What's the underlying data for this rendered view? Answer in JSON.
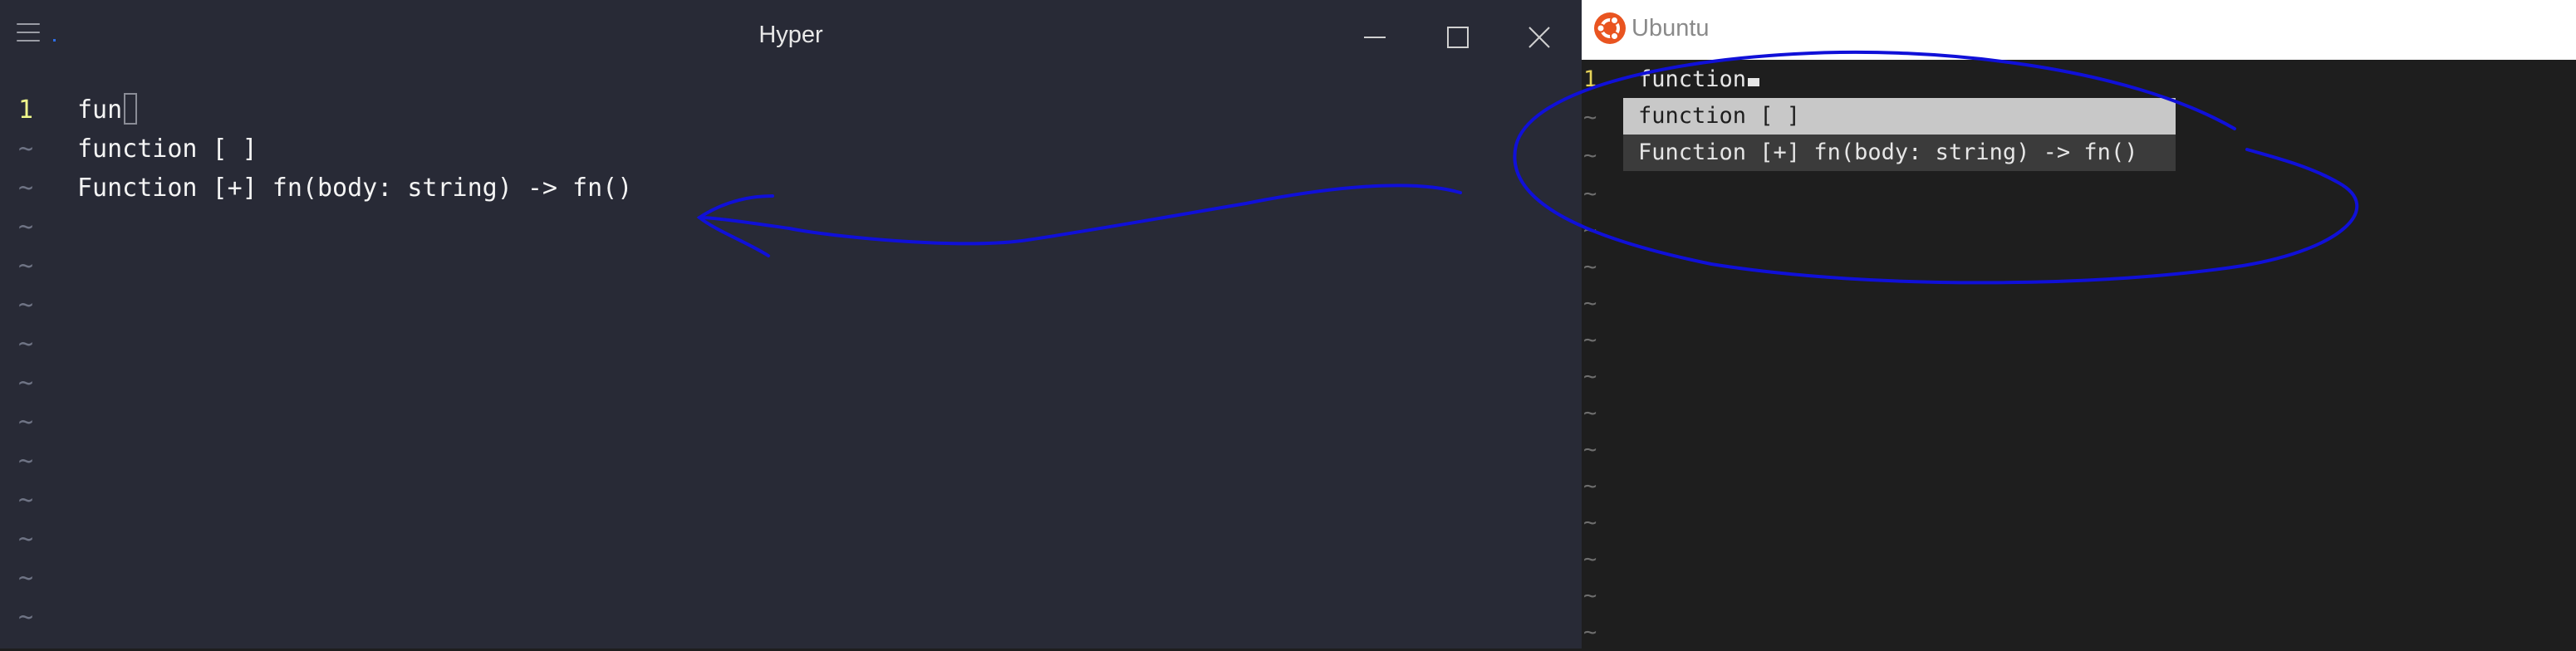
{
  "hyper": {
    "title": "Hyper",
    "lines": [
      {
        "gutter": "1",
        "text": "fun"
      },
      {
        "gutter": "~",
        "text": "function [ ]"
      },
      {
        "gutter": "~",
        "text": "Function [+] fn(body: string) -> fn()"
      },
      {
        "gutter": "~",
        "text": ""
      },
      {
        "gutter": "~",
        "text": ""
      },
      {
        "gutter": "~",
        "text": ""
      },
      {
        "gutter": "~",
        "text": ""
      },
      {
        "gutter": "~",
        "text": ""
      },
      {
        "gutter": "~",
        "text": ""
      },
      {
        "gutter": "~",
        "text": ""
      },
      {
        "gutter": "~",
        "text": ""
      },
      {
        "gutter": "~",
        "text": ""
      },
      {
        "gutter": "~",
        "text": ""
      },
      {
        "gutter": "~",
        "text": ""
      }
    ]
  },
  "ubuntu": {
    "title": "Ubuntu",
    "lines": [
      {
        "gutter": "1",
        "text": "function"
      },
      {
        "gutter": "~",
        "text": ""
      },
      {
        "gutter": "~",
        "text": ""
      },
      {
        "gutter": "~",
        "text": ""
      },
      {
        "gutter": "~",
        "text": ""
      },
      {
        "gutter": "~",
        "text": ""
      },
      {
        "gutter": "~",
        "text": ""
      },
      {
        "gutter": "~",
        "text": ""
      },
      {
        "gutter": "~",
        "text": ""
      },
      {
        "gutter": "~",
        "text": ""
      },
      {
        "gutter": "~",
        "text": ""
      },
      {
        "gutter": "~",
        "text": ""
      },
      {
        "gutter": "~",
        "text": ""
      },
      {
        "gutter": "~",
        "text": ""
      },
      {
        "gutter": "~",
        "text": ""
      },
      {
        "gutter": "~",
        "text": ""
      }
    ],
    "completion": [
      {
        "text": "function [ ]",
        "selected": true
      },
      {
        "text": "Function [+] fn(body: string) -> fn()",
        "selected": false
      }
    ]
  },
  "colors": {
    "hyper_bg": "#282a36",
    "ubuntu_bg": "#1e1e1e",
    "line_number": "#f1fa8c",
    "annotation": "#1010d8",
    "ubuntu_logo": "#e95420"
  },
  "icons": [
    "menu-icon",
    "minimize-icon",
    "maximize-icon",
    "close-icon",
    "ubuntu-logo-icon"
  ]
}
